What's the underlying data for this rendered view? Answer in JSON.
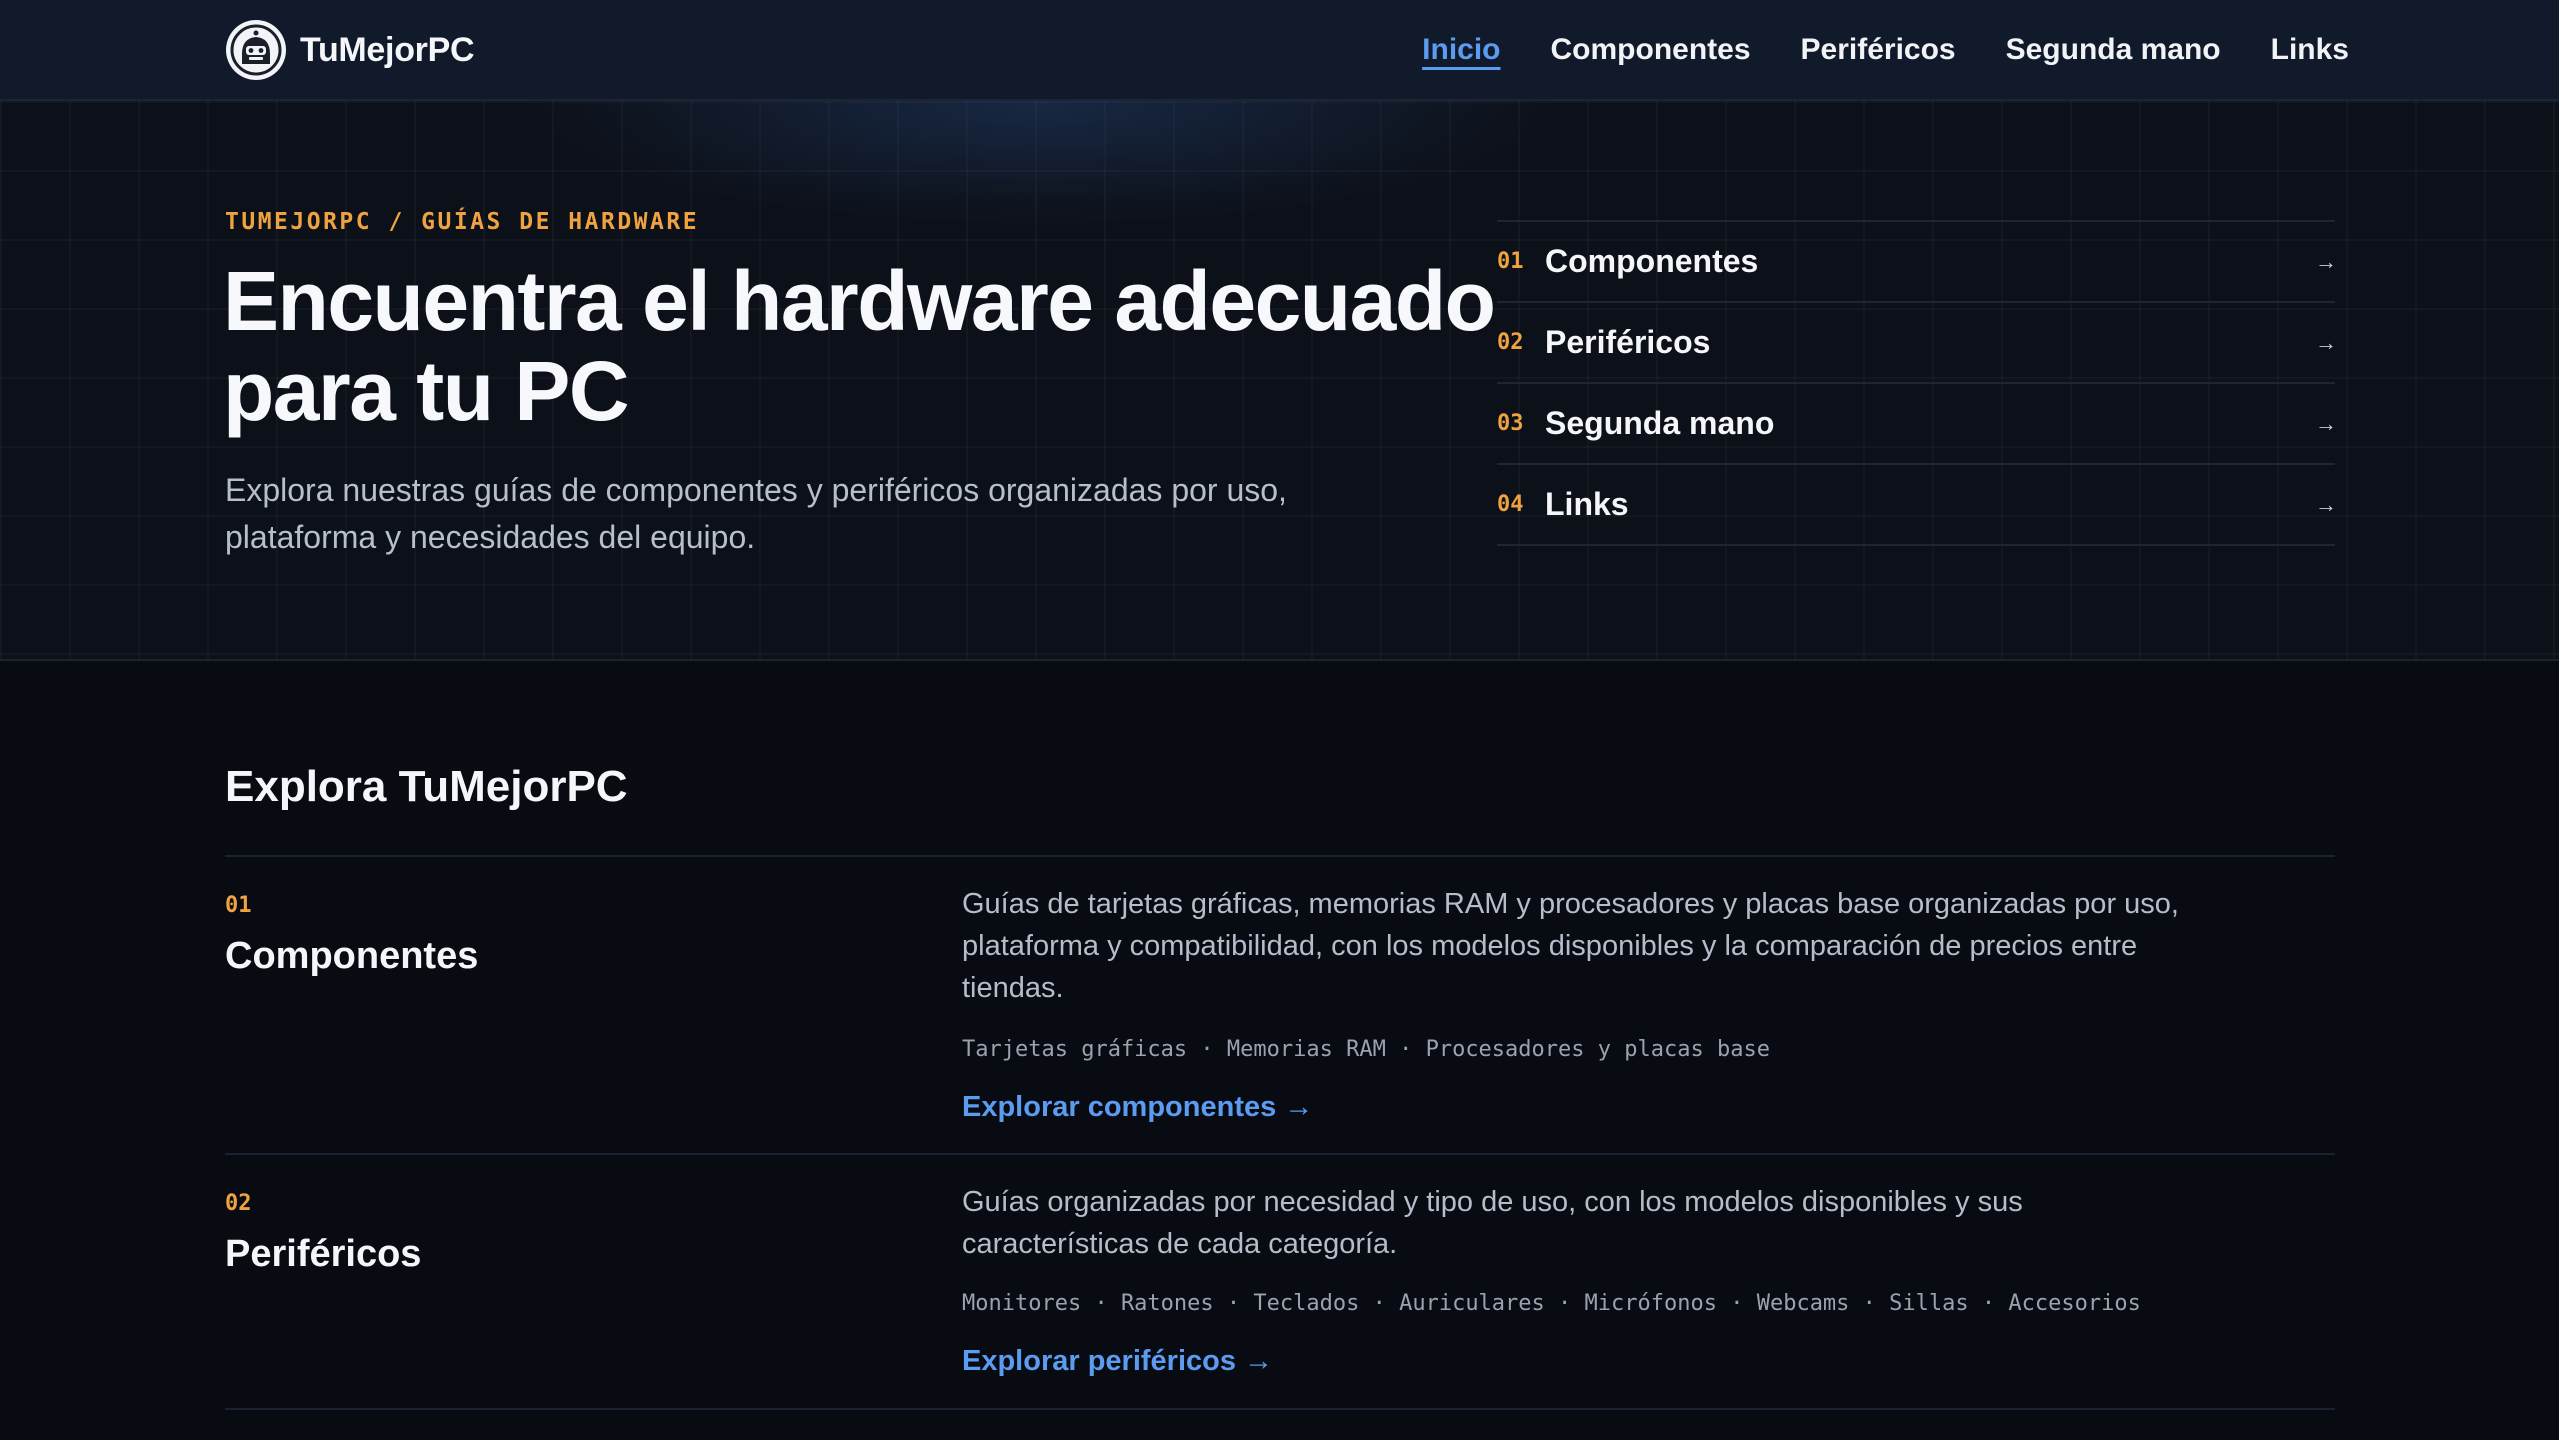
{
  "header": {
    "brand": "TuMejorPC",
    "logo_icon": "helmet-avatar-icon",
    "nav": [
      "Inicio",
      "Componentes",
      "Periféricos",
      "Segunda mano",
      "Links"
    ],
    "active_nav": "Inicio"
  },
  "hero": {
    "eyebrow": "TUMEJORPC / GUÍAS DE HARDWARE",
    "title": "Encuentra el hardware adecuado para tu PC",
    "subtitle": "Explora nuestras guías de componentes y periféricos organizadas por uso, plataforma y necesidades del equipo.",
    "quick_links": [
      {
        "num": "01",
        "label": "Componentes",
        "arrow": "→"
      },
      {
        "num": "02",
        "label": "Periféricos",
        "arrow": "→"
      },
      {
        "num": "03",
        "label": "Segunda mano",
        "arrow": "→"
      },
      {
        "num": "04",
        "label": "Links",
        "arrow": "→"
      }
    ]
  },
  "explore": {
    "title": "Explora TuMejorPC",
    "items": [
      {
        "num": "01",
        "title": "Componentes",
        "description": "Guías de tarjetas gráficas, memorias RAM y procesadores y placas base organizadas por uso, plataforma y compatibilidad, con los modelos disponibles y la comparación de precios entre tiendas.",
        "tags": "Tarjetas gráficas · Memorias RAM · Procesadores y placas base",
        "link": "Explorar componentes →"
      },
      {
        "num": "02",
        "title": "Periféricos",
        "description": "Guías organizadas por necesidad y tipo de uso, con los modelos disponibles y sus características de cada categoría.",
        "tags": "Monitores · Ratones · Teclados · Auriculares · Micrófonos · Webcams · Sillas · Accesorios",
        "link": "Explorar periféricos →"
      }
    ]
  },
  "colors": {
    "accent_blue": "#5b9bf0",
    "accent_orange": "#f0a240",
    "background": "#080b12",
    "header_bg": "#111a2a"
  }
}
